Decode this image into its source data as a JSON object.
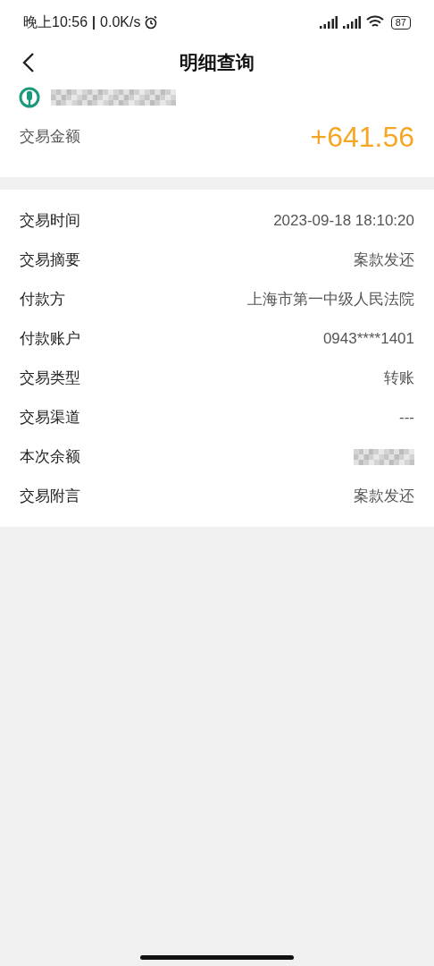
{
  "status_bar": {
    "time": "晚上10:56",
    "speed": "0.0K/s",
    "battery": "87"
  },
  "header": {
    "title": "明细查询"
  },
  "account": {
    "kind": "redacted"
  },
  "amount": {
    "label": "交易金额",
    "value": "+641.56"
  },
  "details": [
    {
      "label": "交易时间",
      "kind": "text",
      "value": "2023-09-18 18:10:20"
    },
    {
      "label": "交易摘要",
      "kind": "text",
      "value": "案款发还"
    },
    {
      "label": "付款方",
      "kind": "text",
      "value": "上海市第一中级人民法院"
    },
    {
      "label": "付款账户",
      "kind": "text",
      "value": "0943****1401"
    },
    {
      "label": "交易类型",
      "kind": "text",
      "value": "转账"
    },
    {
      "label": "交易渠道",
      "kind": "text",
      "value": "---"
    },
    {
      "label": "本次余额",
      "kind": "redacted"
    },
    {
      "label": "交易附言",
      "kind": "text",
      "value": "案款发还"
    }
  ]
}
